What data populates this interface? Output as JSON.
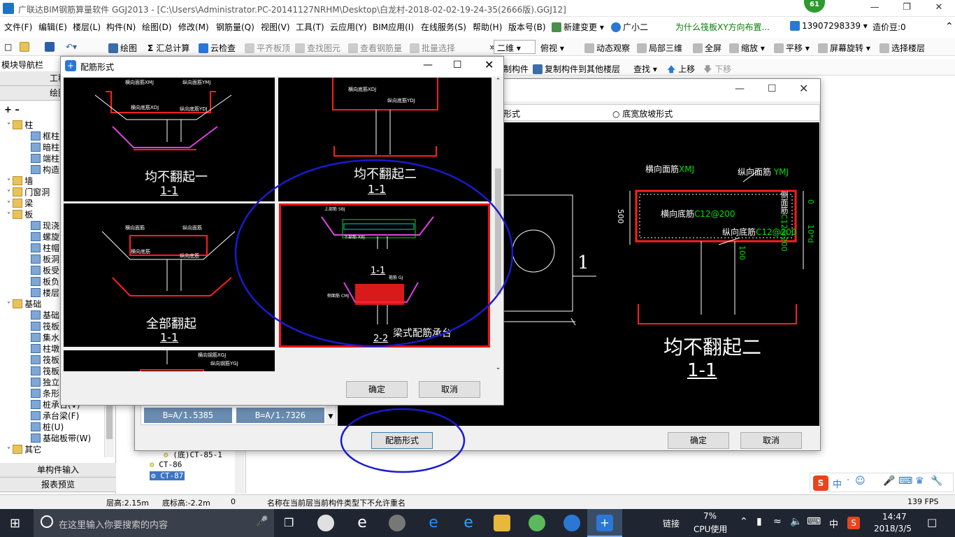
{
  "window": {
    "title": "广联达BIM钢筋算量软件 GGJ2013 - [C:\\Users\\Administrator.PC-20141127NRHM\\Desktop\\白龙村-2018-02-02-19-24-35(2666版).GGJ12]",
    "badge": "61"
  },
  "menu": [
    "文件(F)",
    "编辑(E)",
    "楼层(L)",
    "构件(N)",
    "绘图(D)",
    "修改(M)",
    "钢筋量(Q)",
    "视图(V)",
    "工具(T)",
    "云应用(Y)",
    "BIM应用(I)",
    "在线服务(S)",
    "帮助(H)",
    "版本号(B)",
    "新建变更 ▾",
    "广小二",
    "为什么筏板XY方向布置...",
    "13907298339 ▾",
    "造价豆:0"
  ],
  "toolbar": {
    "draw": "绘图",
    "sum": "汇总计算",
    "cloud_check": "云检查",
    "flat_top": "平齐板顶",
    "find_elem": "查找图元",
    "view_rebar": "查看钢筋量",
    "batch_select": "批量选择",
    "view2d": "二维",
    "top_view": "俯视",
    "dynamic": "动态观察",
    "local3d": "局部三维",
    "fullscreen": "全屏",
    "zoom": "缩放",
    "pan": "平移",
    "rotate": "屏幕旋转",
    "select_floor": "选择楼层",
    "copy_elem": "制构件",
    "copy_to_floor": "复制构件到其他楼层",
    "find": "查找",
    "move_up": "上移",
    "move_down": "下移"
  },
  "left_panel": {
    "header": "模块导航栏",
    "section1": "工程",
    "section2": "绘图",
    "tree": [
      {
        "label": "柱",
        "type": "folder"
      },
      {
        "label": "框柱",
        "type": "item"
      },
      {
        "label": "暗柱",
        "type": "item"
      },
      {
        "label": "端柱",
        "type": "item"
      },
      {
        "label": "构造",
        "type": "item"
      },
      {
        "label": "墙",
        "type": "folder"
      },
      {
        "label": "门窗洞",
        "type": "folder"
      },
      {
        "label": "梁",
        "type": "folder"
      },
      {
        "label": "板",
        "type": "folder"
      },
      {
        "label": "现浇",
        "type": "item"
      },
      {
        "label": "螺旋",
        "type": "item"
      },
      {
        "label": "柱帽",
        "type": "item"
      },
      {
        "label": "板洞",
        "type": "item"
      },
      {
        "label": "板受",
        "type": "item"
      },
      {
        "label": "板负",
        "type": "item"
      },
      {
        "label": "楼层",
        "type": "item"
      },
      {
        "label": "基础",
        "type": "folder"
      },
      {
        "label": "基础",
        "type": "item"
      },
      {
        "label": "筏板",
        "type": "item"
      },
      {
        "label": "集水",
        "type": "item"
      },
      {
        "label": "柱墩",
        "type": "item"
      },
      {
        "label": "筏板",
        "type": "item"
      },
      {
        "label": "筏板",
        "type": "item"
      },
      {
        "label": "独立",
        "type": "item"
      },
      {
        "label": "条形",
        "type": "item"
      },
      {
        "label": "桩承台(V)",
        "type": "item"
      },
      {
        "label": "承台梁(F)",
        "type": "item"
      },
      {
        "label": "桩(U)",
        "type": "item"
      },
      {
        "label": "基础板带(W)",
        "type": "item"
      },
      {
        "label": "其它",
        "type": "folder"
      }
    ],
    "single_input": "单构件输入",
    "report": "报表预览"
  },
  "list_items": [
    "(底)CT-85-1",
    "CT-86",
    "CT-87"
  ],
  "slope_boxes": [
    "B=A/1.5385",
    "B=A/1.7326"
  ],
  "dialog_back": {
    "radio_label_left": "形式",
    "radio_label": "底宽放坡形式",
    "rebar_form_button": "配筋形式",
    "ok": "确定",
    "cancel": "取消",
    "cad": {
      "label_xmj": "横向面筋",
      "label_xmj_code": "XMJ",
      "label_ymj": "纵向面筋",
      "label_ymj_code": "YMJ",
      "label_xdj": "横向底筋",
      "label_xdj_value": "C12@200",
      "label_ydj": "纵向底筋",
      "label_ydj_value": "C12@200",
      "label_side": "侧面筋",
      "label_side_value": "C12@200",
      "dim_500": "500",
      "dim_0": "0",
      "dim_10d": "10*d",
      "dim_100": "100",
      "section_one": "1",
      "caption": "均不翻起二",
      "caption_sub": "1-1"
    }
  },
  "dialog_front": {
    "title": "配筋形式",
    "ok": "确定",
    "cancel": "取消",
    "options": [
      {
        "caption": "均不翻起一",
        "sub": "1-1",
        "xmj": "横向面筋XMJ",
        "ymj": "纵向面筋YMJ",
        "xdj": "横向底筋XDJ",
        "ydj": "纵向底筋YDJ"
      },
      {
        "caption": "均不翻起二",
        "sub": "1-1",
        "xdj": "横向底筋XDJ",
        "ydj": "纵向底筋YDJ"
      },
      {
        "caption": "全部翻起",
        "sub": "1-1",
        "xmj": "横向面筋",
        "ymj": "纵向面筋",
        "xdj": "横向底筋",
        "ydj": "纵向底筋"
      },
      {
        "caption": "梁式配筋承台",
        "sub": "1-1",
        "sub2": "2-2",
        "selected": true,
        "top": "上部筋 SBJ",
        "bottom": "下部筋 XBJ",
        "side": "侧面筋 CMJ",
        "stir": "箍筋 GJ"
      },
      {
        "caption": "",
        "sub": "",
        "xgj": "横向钢筋XGJ",
        "ygj": "纵向钢筋YGJ"
      }
    ]
  },
  "status": {
    "floor_height": "层高:2.15m",
    "bottom_height": "底标高:-2.2m",
    "zero": "0",
    "message": "名称在当前层当前构件类型下不允许重名",
    "fps": "139 FPS"
  },
  "taskbar": {
    "search_placeholder": "在这里输入你要搜索的内容",
    "link": "链接",
    "cpu_value": "7%",
    "cpu_label": "CPU使用",
    "ime": "中",
    "time": "14:47",
    "date": "2018/3/5"
  },
  "ime_bar": [
    "中",
    "·",
    "☺"
  ],
  "colors": {
    "cad_bg": "#000000",
    "red": "#ff1e1e",
    "magenta": "#e040e0",
    "green": "#00e000",
    "ellipse": "#1a1ad0",
    "taskbar": "#1f2631"
  }
}
